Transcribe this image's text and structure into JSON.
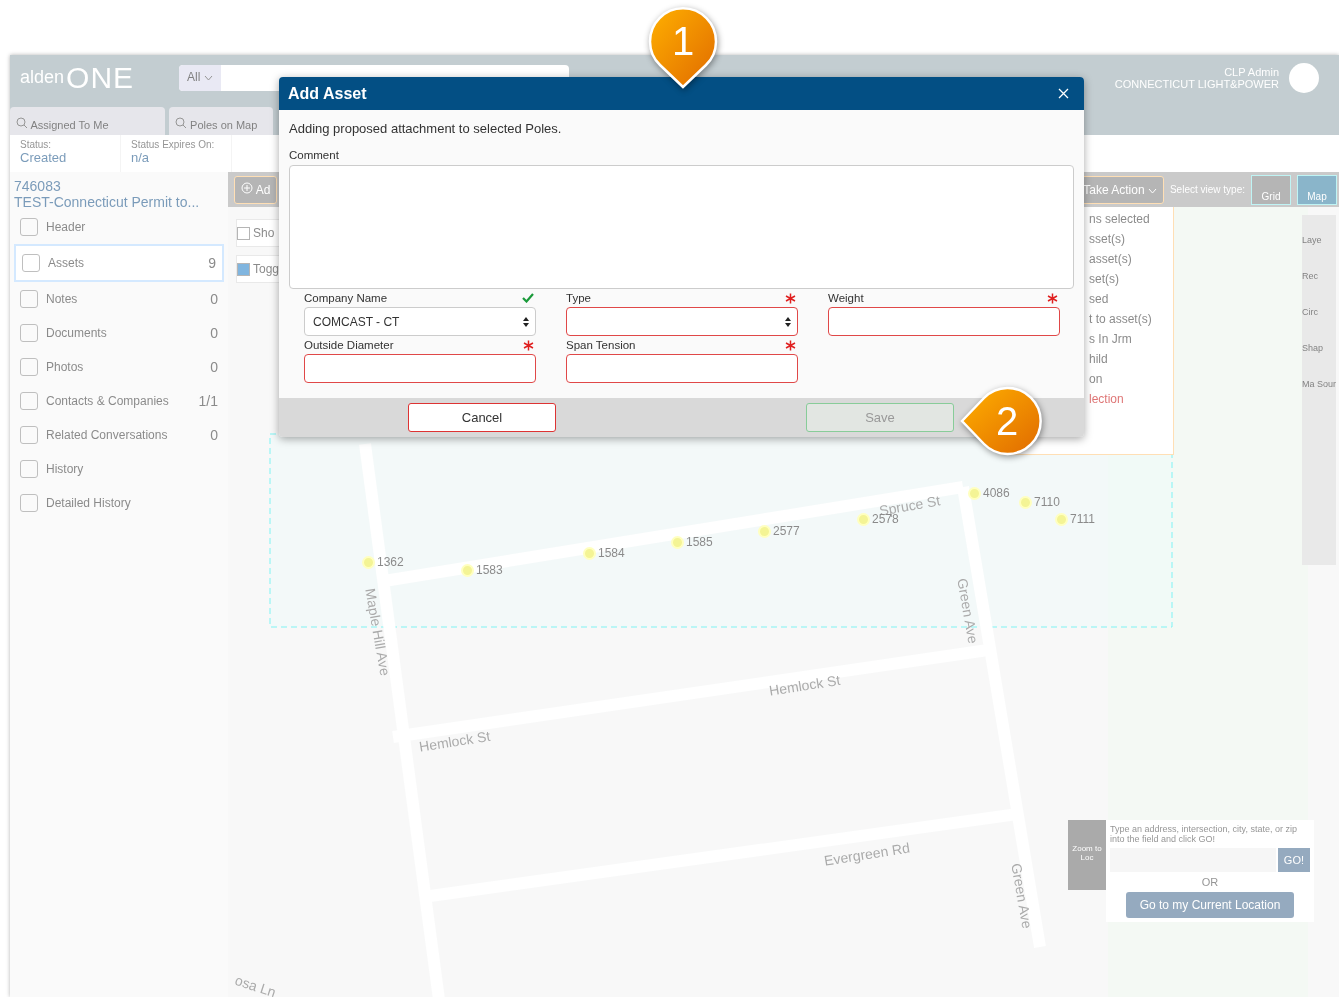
{
  "app": {
    "logo_text": "alden",
    "logo_mark": "ONE",
    "search_scope": "All",
    "user_name": "CLP Admin",
    "company": "CONNECTICUT LIGHT&POWER",
    "tabs": [
      {
        "label": "Assigned To Me",
        "selected": false
      },
      {
        "label": "Poles on Map",
        "selected": false
      }
    ],
    "status_fields": [
      {
        "label": "Status:",
        "value": "Created"
      },
      {
        "label": "Status Expires On:",
        "value": "n/a"
      }
    ],
    "record": {
      "number": "746083",
      "title": "TEST-Connecticut Permit to..."
    },
    "sidebar": [
      {
        "label": "Header",
        "selected": false
      },
      {
        "label": "Assets",
        "count": "9",
        "selected": true
      },
      {
        "label": "Notes",
        "count": "0",
        "selected": false
      },
      {
        "label": "Documents",
        "count": "0",
        "selected": false
      },
      {
        "label": "Photos",
        "count": "0",
        "selected": false
      },
      {
        "label": "Contacts & Companies",
        "count": "1/1",
        "selected": false
      },
      {
        "label": "Related Conversations",
        "count": "0",
        "selected": false
      },
      {
        "label": "History",
        "selected": false
      },
      {
        "label": "Detailed History",
        "selected": false
      }
    ],
    "toolbar": {
      "add_button": "Ad",
      "action_button": "Take Action",
      "view_label": "Select view type:",
      "views": [
        {
          "label": "Grid",
          "selected": false
        },
        {
          "label": "Map",
          "selected": true
        }
      ]
    },
    "checkboxes": [
      {
        "label": "Sho",
        "checked": false
      },
      {
        "label": "Togg",
        "checked": true
      }
    ],
    "action_menu": [
      "ns selected",
      "sset(s)",
      "asset(s)",
      "set(s)",
      "sed",
      "t to asset(s)",
      "s In Jrm",
      "hild",
      "on",
      "lection"
    ],
    "map": {
      "streets": [
        "Spruce St",
        "Maple Hill Ave",
        "Green Ave",
        "Hemlock St",
        "Hemlock St",
        "Green Ave",
        "Evergreen Rd",
        "osa Ln"
      ],
      "poles": [
        "1362",
        "1583",
        "1584",
        "1585",
        "2577",
        "2578",
        "4086",
        "7110",
        "7111"
      ]
    },
    "map_tools": [
      "Laye",
      "Rec",
      "Circ",
      "Shap",
      "Ma Sour"
    ],
    "zoom_panel": {
      "tab_label": "Zoom to Loc",
      "hint": "Type an address, intersection, city, state, or zip into the field and click GO!",
      "go_button": "GO!",
      "or": "OR",
      "current_location_button": "Go to my Current Location"
    }
  },
  "dialog": {
    "title": "Add Asset",
    "intro": "Adding proposed attachment to selected Poles.",
    "comment_label": "Comment",
    "fields": [
      {
        "label": "Company Name",
        "kind": "select",
        "value": "COMCAST - CT",
        "valid": true,
        "required": false
      },
      {
        "label": "Type",
        "kind": "select",
        "valid": false,
        "required": true
      },
      {
        "label": "Weight",
        "kind": "input",
        "valid": false,
        "required": true
      },
      {
        "label": "Outside Diameter",
        "kind": "input",
        "valid": false,
        "required": true
      },
      {
        "label": "Span Tension",
        "kind": "input",
        "valid": false,
        "required": true
      }
    ],
    "cancel": "Cancel",
    "save": {
      "label": "Save",
      "disabled": true
    }
  },
  "callouts": [
    "1",
    "2"
  ]
}
